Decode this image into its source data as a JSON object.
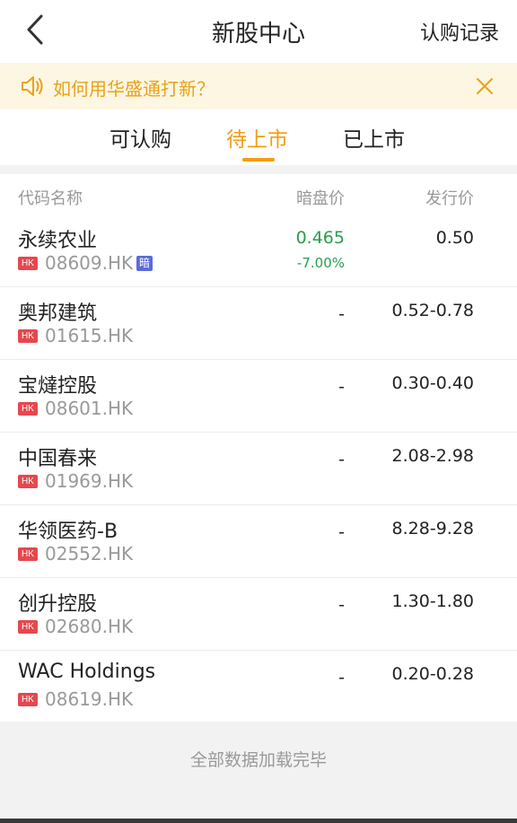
{
  "header": {
    "title": "新股中心",
    "record_link": "认购记录"
  },
  "notice": {
    "text": "如何用华盛通打新？"
  },
  "tabs": [
    {
      "label": "可认购",
      "active": false
    },
    {
      "label": "待上市",
      "active": true
    },
    {
      "label": "已上市",
      "active": false
    }
  ],
  "columns": {
    "name": "代码名称",
    "dark_price": "暗盘价",
    "issue_price": "发行价"
  },
  "market_badge": "HK",
  "dark_badge": "暗",
  "rows": [
    {
      "name": "永续农业",
      "code": "08609.HK",
      "dark_price": "0.465",
      "dark_change": "-7.00%",
      "issue_price": "0.50",
      "has_dark": true
    },
    {
      "name": "奥邦建筑",
      "code": "01615.HK",
      "dark_price": "-",
      "dark_change": "",
      "issue_price": "0.52-0.78",
      "has_dark": false
    },
    {
      "name": "宝燵控股",
      "code": "08601.HK",
      "dark_price": "-",
      "dark_change": "",
      "issue_price": "0.30-0.40",
      "has_dark": false
    },
    {
      "name": "中国春来",
      "code": "01969.HK",
      "dark_price": "-",
      "dark_change": "",
      "issue_price": "2.08-2.98",
      "has_dark": false
    },
    {
      "name": "华领医药-B",
      "code": "02552.HK",
      "dark_price": "-",
      "dark_change": "",
      "issue_price": "8.28-9.28",
      "has_dark": false
    },
    {
      "name": "创升控股",
      "code": "02680.HK",
      "dark_price": "-",
      "dark_change": "",
      "issue_price": "1.30-1.80",
      "has_dark": false
    },
    {
      "name": "WAC Holdings",
      "code": "08619.HK",
      "dark_price": "-",
      "dark_change": "",
      "issue_price": "0.20-0.28",
      "has_dark": false
    }
  ],
  "footer": {
    "text": "全部数据加载完毕"
  },
  "colors": {
    "accent": "#f39c12",
    "notice_bg": "#fdf6e3",
    "down_green": "#2a9d4a",
    "hk_badge": "#e5484d",
    "dark_badge": "#5b6bd6"
  }
}
